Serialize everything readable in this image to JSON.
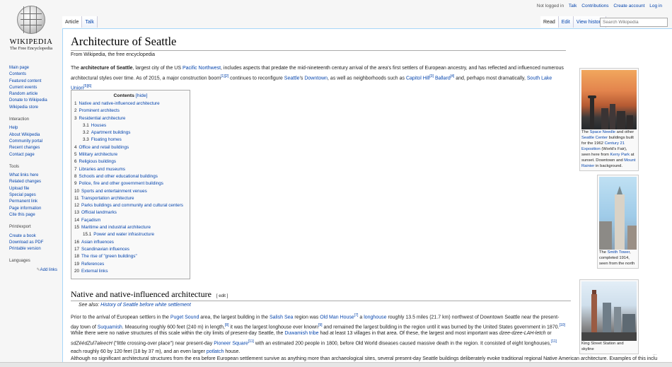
{
  "logo": {
    "wordmark": "WIKIPEDIA",
    "tagline": "The Free Encyclopedia"
  },
  "personal": {
    "not_logged_in": "Not logged in",
    "talk": "Talk",
    "contributions": "Contributions",
    "create_account": "Create account",
    "log_in": "Log in"
  },
  "tabs_left": [
    "Article",
    "Talk"
  ],
  "tabs_right": [
    "Read",
    "Edit",
    "View history"
  ],
  "search": {
    "placeholder": "Search Wikipedia"
  },
  "sidebar": {
    "nav": [
      "Main page",
      "Contents",
      "Featured content",
      "Current events",
      "Random article",
      "Donate to Wikipedia",
      "Wikipedia store"
    ],
    "interaction_heading": "Interaction",
    "interaction": [
      "Help",
      "About Wikipedia",
      "Community portal",
      "Recent changes",
      "Contact page"
    ],
    "tools_heading": "Tools",
    "tools": [
      "What links here",
      "Related changes",
      "Upload file",
      "Special pages",
      "Permanent link",
      "Page information",
      "Cite this page"
    ],
    "print_heading": "Print/export",
    "print": [
      "Create a book",
      "Download as PDF",
      "Printable version"
    ],
    "languages_heading": "Languages",
    "add_links": "Add links"
  },
  "page": {
    "title": "Architecture of Seattle",
    "from_wiki": "From Wikipedia, the free encyclopedia"
  },
  "intro": {
    "t1": "The ",
    "b1": "architecture of Seattle",
    "t2": ", largest city of the US ",
    "l1": "Pacific Northwest",
    "t3": ", includes aspects that predate the mid-nineteenth century arrival of the area's first settlers of European ancestry, and has reflected and influenced numerous architectural styles over time. As of 2015, a major construction boom",
    "s1": "[1][2]",
    "t4": " continues to reconfigure ",
    "l2": "Seattle",
    "t5": "'s ",
    "l3": "Downtown",
    "t6": ", as well as neighborhoods such as ",
    "l4": "Capitol Hill",
    "s2": "[3]",
    "t7": " ",
    "l5": "Ballard",
    "s3": "[4]",
    "t8": " and, perhaps most dramatically, ",
    "l6": "South Lake Union",
    "s4": "[5][6]"
  },
  "toc": {
    "title": "Contents",
    "hide": "[hide]",
    "items": [
      {
        "num": "1",
        "label": "Native and native-influenced architecture",
        "sub": false
      },
      {
        "num": "2",
        "label": "Prominent architects",
        "sub": false
      },
      {
        "num": "3",
        "label": "Residential architecture",
        "sub": false
      },
      {
        "num": "3.1",
        "label": "Houses",
        "sub": true
      },
      {
        "num": "3.2",
        "label": "Apartment buildings",
        "sub": true
      },
      {
        "num": "3.3",
        "label": "Floating homes",
        "sub": true
      },
      {
        "num": "4",
        "label": "Office and retail buildings",
        "sub": false
      },
      {
        "num": "5",
        "label": "Military architecture",
        "sub": false
      },
      {
        "num": "6",
        "label": "Religious buildings",
        "sub": false
      },
      {
        "num": "7",
        "label": "Libraries and museums",
        "sub": false
      },
      {
        "num": "8",
        "label": "Schools and other educational buildings",
        "sub": false
      },
      {
        "num": "9",
        "label": "Police, fire and other government buildings",
        "sub": false
      },
      {
        "num": "10",
        "label": "Sports and entertainment venues",
        "sub": false
      },
      {
        "num": "11",
        "label": "Transportation architecture",
        "sub": false
      },
      {
        "num": "12",
        "label": "Parks buildings and community and cultural centers",
        "sub": false
      },
      {
        "num": "13",
        "label": "Official landmarks",
        "sub": false
      },
      {
        "num": "14",
        "label": "Façadism",
        "sub": false
      },
      {
        "num": "15",
        "label": "Maritime and industrial architecture",
        "sub": false
      },
      {
        "num": "15.1",
        "label": "Power and water infrastructure",
        "sub": true
      },
      {
        "num": "16",
        "label": "Asian influences",
        "sub": false
      },
      {
        "num": "17",
        "label": "Scandinavian influences",
        "sub": false
      },
      {
        "num": "18",
        "label": "The rise of \"green buildings\"",
        "sub": false
      },
      {
        "num": "19",
        "label": "References",
        "sub": false
      },
      {
        "num": "20",
        "label": "External links",
        "sub": false
      }
    ]
  },
  "section1": {
    "heading": "Native and native-influenced architecture",
    "edit": "[ edit ]",
    "see_also_prefix": "See also: ",
    "see_also_link": "History of Seattle before white settlement"
  },
  "para2": {
    "t1": "Prior to the arrival of European settlers in the ",
    "l1": "Puget Sound",
    "t2": " area, the largest building in the ",
    "l2": "Salish Sea",
    "t3": " region was ",
    "l3": "Old Man House",
    "s1": "[7]",
    "t4": " a ",
    "l4": "longhouse",
    "t5": " roughly 13.5 miles (21.7 km) northwest of Downtown Seattle near the present-day town of ",
    "l5": "Suquamish",
    "t6": ". Measuring roughly 600 feet (240 m) in length,",
    "s2": "[8]",
    "t7": " it was the largest longhouse ever known",
    "s3": "[9]",
    "t8": " and remained the largest building in the region until it was burned by the United States government in 1870.",
    "s4": "[10]"
  },
  "para3": {
    "t1": "While there were no native structures of this scale within the city limits of present-day Seattle, the ",
    "l1": "Duwamish tribe",
    "t2": " had at least 13 villages in that area. Of these, the largest and most important was ",
    "i1": "dzee-dzee-LAH-letch",
    "t3": " or ",
    "i2": "sdZéédZul7aleecH",
    "t4": " (\"little crossing-over place\") near present-day ",
    "l2": "Pioneer Square",
    "s1": "[11]",
    "t5": " with an estimated 200 people in 1800, before Old World diseases caused massive death in the region. It consisted of eight longhouses,",
    "s2": "[11]",
    "t6": " each roughly 60 by 120 feet (18 by 37 m), and an even larger ",
    "l3": "potlatch",
    "t7": " house."
  },
  "para4": {
    "t1": "Although no significant architectural structures from the era before European settlement survive as anything more than archaeological sites, several present-day Seattle buildings deliberately evoke traditional regional Native American architecture. Examples of this inclu"
  },
  "thumb1": {
    "t1": "The ",
    "l1": "Space Needle",
    "t2": " and other ",
    "l2": "Seattle Center",
    "t3": " buildings built for the 1962 ",
    "l3": "Century 21 Exposition",
    "t4": " (World's Fair), seen here from ",
    "l4": "Kerry Park",
    "t5": " at sunset. Downtown and ",
    "l5": "Mount Rainier",
    "t6": " in background."
  },
  "thumb2": {
    "t1": "The ",
    "l1": "Smith Tower",
    "t2": ", completed 1914, seen from the north"
  },
  "thumb3": {
    "t1": "King Street Station and skyline"
  },
  "status": {
    "corner": "..."
  },
  "colors": {
    "link": "#0645ad",
    "content_border": "#a7d7f9",
    "chrome_bg": "#f6f6f6"
  }
}
